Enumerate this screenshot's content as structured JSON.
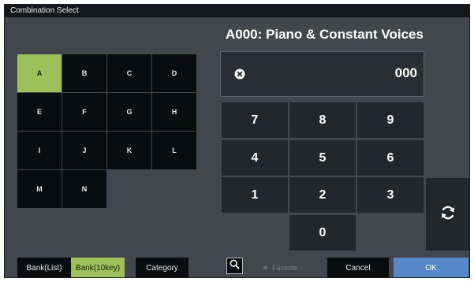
{
  "window": {
    "title": "Combination Select"
  },
  "program_name": "A000: Piano & Constant Voices",
  "display": {
    "number": "000",
    "icon": "close-circle-icon"
  },
  "banks": [
    "A",
    "B",
    "C",
    "D",
    "E",
    "F",
    "G",
    "H",
    "I",
    "J",
    "K",
    "L",
    "M",
    "N"
  ],
  "selected_bank": "A",
  "keypad": [
    "7",
    "8",
    "9",
    "4",
    "5",
    "6",
    "1",
    "2",
    "3",
    "0"
  ],
  "refresh_icon": "refresh-icon",
  "bottom": {
    "bank_list": "Bank(List)",
    "bank_10key": "Bank(10key)",
    "category": "Category",
    "search_icon": "search-icon",
    "favorite": "Favorite",
    "cancel": "Cancel",
    "ok": "OK"
  },
  "colors": {
    "selected_green": "#9cc05a",
    "ok_blue": "#5488c8",
    "panel": "#43464d",
    "key": "#23262d"
  }
}
